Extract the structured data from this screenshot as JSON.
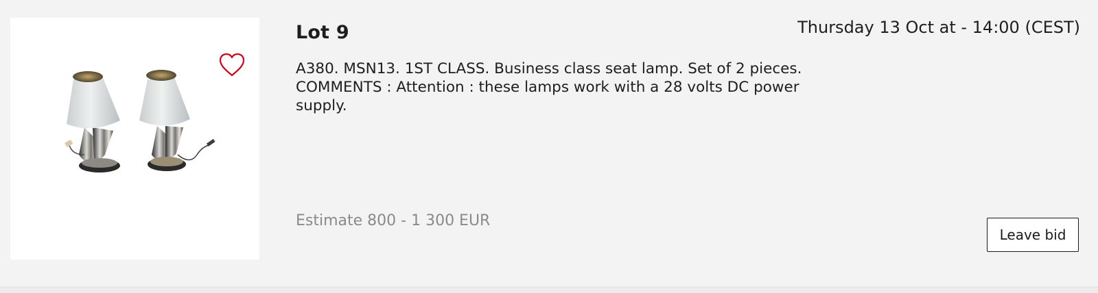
{
  "lot": {
    "title": "Lot 9",
    "date": "Thursday 13 Oct at - 14:00 (CEST)",
    "description": "A380. MSN13. 1ST CLASS. Business class seat lamp. Set of 2 pieces. COMMENTS : Attention : these lamps work with a 28 volts DC power supply.",
    "estimate": "Estimate 800 - 1 300 EUR",
    "bid_label": "Leave bid",
    "favorite_icon": "heart-outline-icon",
    "image_subject": "Two business class seat lamps"
  },
  "colors": {
    "background": "#f3f3f3",
    "favorite_accent": "#d0021b",
    "estimate_text": "#8a8a8a"
  }
}
